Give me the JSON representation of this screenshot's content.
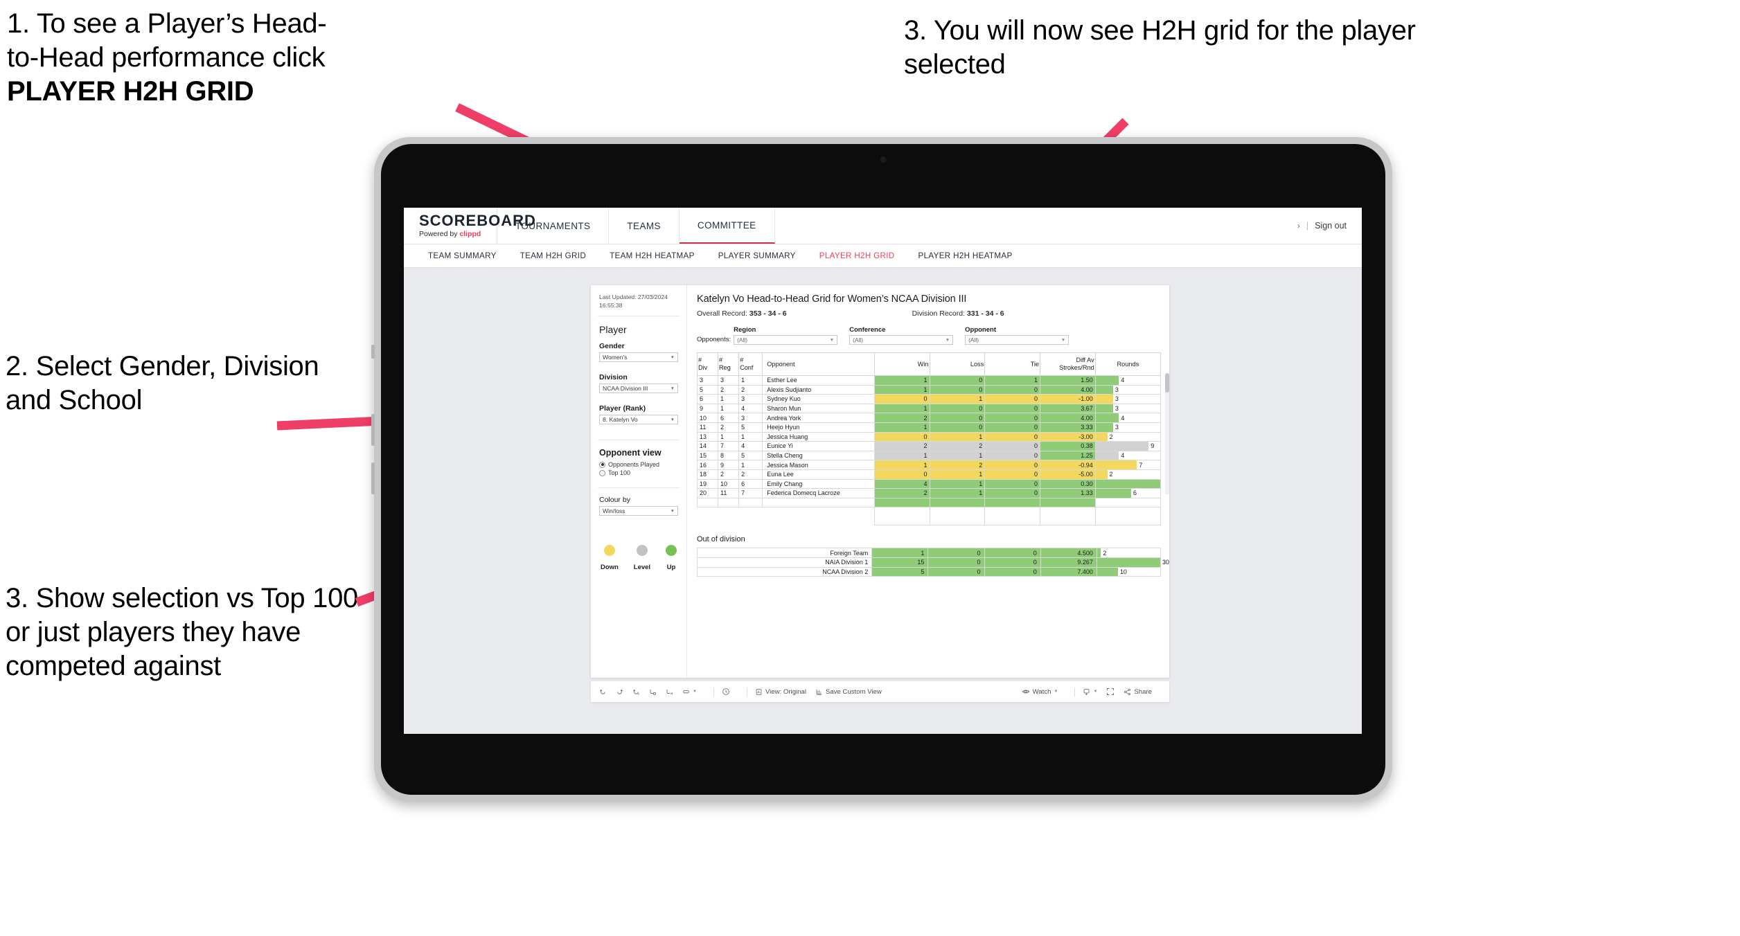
{
  "annotations": {
    "callout_1_line1": "1. To see a Player’s Head-",
    "callout_1_line2": "to-Head performance click",
    "callout_1_bold": "PLAYER H2H GRID",
    "callout_2": "2. Select Gender, Division and School",
    "callout_3": "3. Show selection vs Top 100 or just players they have competed against",
    "callout_4": "3. You will now see H2H grid for the player selected",
    "arrow_color": "#ef3e68"
  },
  "app": {
    "brand": {
      "title": "SCOREBOARD",
      "powered_prefix": "Powered by ",
      "powered_brand": "clippd"
    },
    "header_nav": [
      {
        "label": "TOURNAMENTS",
        "active": false
      },
      {
        "label": "TEAMS",
        "active": false
      },
      {
        "label": "COMMITTEE",
        "active": true
      }
    ],
    "header_right": {
      "chevron": "›",
      "separator": "|",
      "sign_out": "Sign out"
    },
    "subnav": [
      {
        "label": "TEAM SUMMARY",
        "active": false
      },
      {
        "label": "TEAM H2H GRID",
        "active": false
      },
      {
        "label": "TEAM H2H HEATMAP",
        "active": false
      },
      {
        "label": "PLAYER SUMMARY",
        "active": false
      },
      {
        "label": "PLAYER H2H GRID",
        "active": true
      },
      {
        "label": "PLAYER H2H HEATMAP",
        "active": false
      }
    ]
  },
  "filters": {
    "last_updated": "Last Updated: 27/03/2024 16:55:38",
    "player_heading": "Player",
    "gender_label": "Gender",
    "gender_value": "Women's",
    "division_label": "Division",
    "division_value": "NCAA Division III",
    "player_rank_label": "Player (Rank)",
    "player_rank_value": "8. Katelyn Vo",
    "opponent_view_heading": "Opponent view",
    "opponent_view_options": [
      {
        "label": "Opponents Played",
        "selected": true
      },
      {
        "label": "Top 100",
        "selected": false
      }
    ],
    "colour_by_label": "Colour by",
    "colour_by_value": "Win/loss",
    "legend": [
      {
        "label": "Down",
        "color": "#f2d85e"
      },
      {
        "label": "Level",
        "color": "#c2c2c2"
      },
      {
        "label": "Up",
        "color": "#77c153"
      }
    ]
  },
  "viz": {
    "title": "Katelyn Vo Head-to-Head Grid for Women’s NCAA Division III",
    "overall_record_label": "Overall Record: ",
    "overall_record_value": "353 -  34 - 6",
    "division_record_label": "Division Record: ",
    "division_record_value": "331 -  34 - 6",
    "opponents_label": "Opponents:",
    "opponent_filters": [
      {
        "label": "Region",
        "value": "(All)"
      },
      {
        "label": "Conference",
        "value": "(All)"
      },
      {
        "label": "Opponent",
        "value": "(All)"
      }
    ]
  },
  "chart_data": {
    "type": "table",
    "title": "Katelyn Vo Head-to-Head Grid for Women’s NCAA Division III",
    "columns": [
      "# Div",
      "# Reg",
      "# Conf",
      "Opponent",
      "Win",
      "Loss",
      "Tie",
      "Diff Av Strokes/Rnd",
      "Rounds"
    ],
    "column_headers_multiline": [
      {
        "l1": "#",
        "l2": "Div"
      },
      {
        "l1": "#",
        "l2": "Reg"
      },
      {
        "l1": "#",
        "l2": "Conf"
      },
      {
        "l1": "Opponent",
        "l2": ""
      },
      {
        "l1": "Win",
        "l2": ""
      },
      {
        "l1": "Loss",
        "l2": ""
      },
      {
        "l1": "Tie",
        "l2": ""
      },
      {
        "l1": "Diff Av",
        "l2": "Strokes/Rnd"
      },
      {
        "l1": "Rounds",
        "l2": ""
      }
    ],
    "rows": [
      {
        "div": "3",
        "reg": "3",
        "conf": "1",
        "opponent": "Esther Lee",
        "win": "1",
        "loss": "0",
        "tie": "1",
        "diff": "1.50",
        "rounds": "4",
        "color": "green",
        "bar_pct": 36
      },
      {
        "div": "5",
        "reg": "2",
        "conf": "2",
        "opponent": "Alexis Sudjianto",
        "win": "1",
        "loss": "0",
        "tie": "0",
        "diff": "4.00",
        "rounds": "3",
        "color": "green",
        "bar_pct": 27
      },
      {
        "div": "6",
        "reg": "1",
        "conf": "3",
        "opponent": "Sydney Kuo",
        "win": "0",
        "loss": "1",
        "tie": "0",
        "diff": "-1.00",
        "rounds": "3",
        "color": "yellow",
        "bar_pct": 27
      },
      {
        "div": "9",
        "reg": "1",
        "conf": "4",
        "opponent": "Sharon Mun",
        "win": "1",
        "loss": "0",
        "tie": "0",
        "diff": "3.67",
        "rounds": "3",
        "color": "green",
        "bar_pct": 27
      },
      {
        "div": "10",
        "reg": "6",
        "conf": "3",
        "opponent": "Andrea York",
        "win": "2",
        "loss": "0",
        "tie": "0",
        "diff": "4.00",
        "rounds": "4",
        "color": "green",
        "bar_pct": 36
      },
      {
        "div": "11",
        "reg": "2",
        "conf": "5",
        "opponent": "Heejo Hyun",
        "win": "1",
        "loss": "0",
        "tie": "0",
        "diff": "3.33",
        "rounds": "3",
        "color": "green",
        "bar_pct": 27
      },
      {
        "div": "13",
        "reg": "1",
        "conf": "1",
        "opponent": "Jessica Huang",
        "win": "0",
        "loss": "1",
        "tie": "0",
        "diff": "-3.00",
        "rounds": "2",
        "color": "yellow",
        "bar_pct": 18
      },
      {
        "div": "14",
        "reg": "7",
        "conf": "4",
        "opponent": "Eunice Yi",
        "win": "2",
        "loss": "2",
        "tie": "0",
        "diff": "0.38",
        "rounds": "9",
        "color": "grey",
        "bar_pct": 82,
        "diff_color": "green"
      },
      {
        "div": "15",
        "reg": "8",
        "conf": "5",
        "opponent": "Stella Cheng",
        "win": "1",
        "loss": "1",
        "tie": "0",
        "diff": "1.25",
        "rounds": "4",
        "color": "grey",
        "bar_pct": 36,
        "diff_color": "green"
      },
      {
        "div": "16",
        "reg": "9",
        "conf": "1",
        "opponent": "Jessica Mason",
        "win": "1",
        "loss": "2",
        "tie": "0",
        "diff": "-0.94",
        "rounds": "7",
        "color": "yellow",
        "bar_pct": 64
      },
      {
        "div": "18",
        "reg": "2",
        "conf": "2",
        "opponent": "Euna Lee",
        "win": "0",
        "loss": "1",
        "tie": "0",
        "diff": "-5.00",
        "rounds": "2",
        "color": "yellow",
        "bar_pct": 18
      },
      {
        "div": "19",
        "reg": "10",
        "conf": "6",
        "opponent": "Emily Chang",
        "win": "4",
        "loss": "1",
        "tie": "0",
        "diff": "0.30",
        "rounds": "11",
        "color": "green",
        "bar_pct": 100
      },
      {
        "div": "20",
        "reg": "11",
        "conf": "7",
        "opponent": "Federica Domecq Lacroze",
        "win": "2",
        "loss": "1",
        "tie": "0",
        "diff": "1.33",
        "rounds": "6",
        "color": "green",
        "bar_pct": 55
      }
    ],
    "out_of_division_title": "Out of division",
    "out_of_division_rows": [
      {
        "label": "Foreign Team",
        "win": "1",
        "loss": "0",
        "tie": "0",
        "diff": "4.500",
        "rounds": "2",
        "color": "green",
        "bar_pct": 6
      },
      {
        "label": "NAIA Division 1",
        "win": "15",
        "loss": "0",
        "tie": "0",
        "diff": "9.267",
        "rounds": "30",
        "color": "green",
        "bar_pct": 100
      },
      {
        "label": "NCAA Division 2",
        "win": "5",
        "loss": "0",
        "tie": "0",
        "diff": "7.400",
        "rounds": "10",
        "color": "green",
        "bar_pct": 33
      }
    ]
  },
  "toolbar": {
    "undo": "undo-icon",
    "redo": "redo-icon",
    "revert": "revert-icon",
    "refresh": "refresh-icon",
    "pause": "pause-icon",
    "layout": "layout-icon",
    "clock": "clock-icon",
    "view_original": "View: Original",
    "save_custom_view": "Save Custom View",
    "watch": "Watch",
    "share": "Share"
  }
}
